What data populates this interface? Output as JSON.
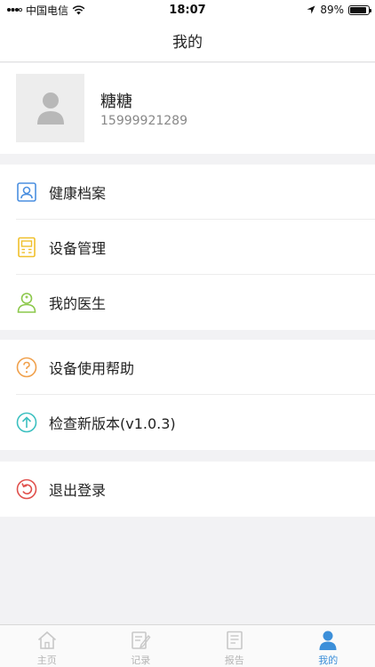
{
  "status_bar": {
    "carrier": "中国电信",
    "time": "18:07",
    "battery": "89%",
    "battery_level": 0.89
  },
  "nav": {
    "title": "我的"
  },
  "profile": {
    "name": "糖糖",
    "phone": "15999921289"
  },
  "menu": {
    "group1": [
      {
        "label": "健康档案",
        "icon": "health-record-icon",
        "color": "#4a8fe0"
      },
      {
        "label": "设备管理",
        "icon": "device-manage-icon",
        "color": "#f0c02c"
      },
      {
        "label": "我的医生",
        "icon": "doctor-icon",
        "color": "#8cc84b"
      }
    ],
    "group2": [
      {
        "label": "设备使用帮助",
        "icon": "help-icon",
        "color": "#f0a04b"
      },
      {
        "label": "检查新版本(v1.0.3)",
        "icon": "update-icon",
        "color": "#3cc0c0"
      }
    ],
    "group3": [
      {
        "label": "退出登录",
        "icon": "logout-icon",
        "color": "#e0504c"
      }
    ]
  },
  "tabbar": {
    "tabs": [
      {
        "label": "主页",
        "icon": "home-icon"
      },
      {
        "label": "记录",
        "icon": "record-icon"
      },
      {
        "label": "报告",
        "icon": "report-icon"
      },
      {
        "label": "我的",
        "icon": "profile-icon",
        "active": true
      }
    ],
    "active_color": "#3c8fd9",
    "inactive_color": "#b5b5b5"
  }
}
